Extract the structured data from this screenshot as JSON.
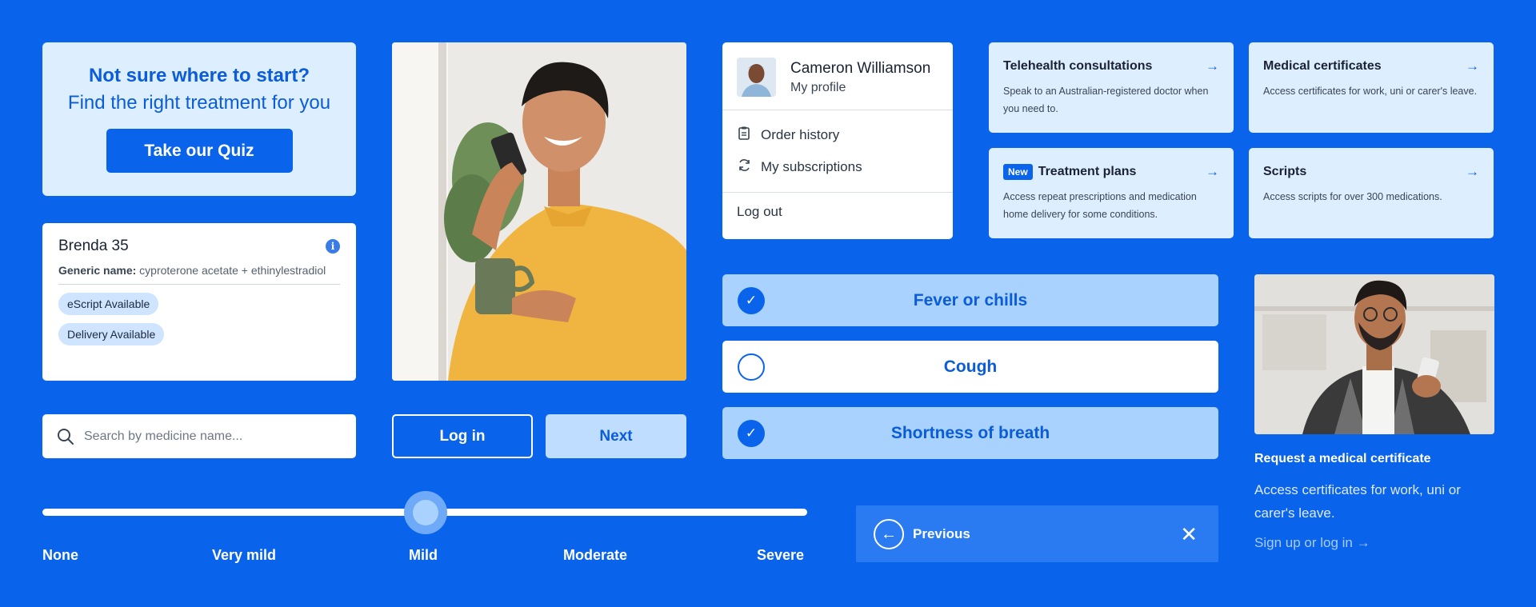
{
  "quiz": {
    "title": "Not sure where to start?",
    "subtitle": "Find the right treatment for you",
    "button_label": "Take our Quiz"
  },
  "medicine": {
    "name": "Brenda 35",
    "generic_label": "Generic name:",
    "generic_value": "cyproterone acetate + ethinylestradiol",
    "badges": [
      "eScript Available",
      "Delivery Available"
    ],
    "info_icon": "info-icon"
  },
  "search": {
    "placeholder": "Search by medicine name...",
    "icon": "search-icon"
  },
  "buttons": {
    "login_label": "Log in",
    "next_label": "Next"
  },
  "profile": {
    "name": "Cameron Williamson",
    "subtitle": "My profile",
    "menu": [
      {
        "label": "Order history",
        "icon": "clipboard-icon"
      },
      {
        "label": "My subscriptions",
        "icon": "refresh-icon"
      }
    ],
    "logout_label": "Log out"
  },
  "services": [
    {
      "title": "Telehealth consultations",
      "desc": "Speak to an Australian-registered doctor when you need to.",
      "badge": ""
    },
    {
      "title": "Medical certificates",
      "desc": "Access certificates for work, uni or carer's leave.",
      "badge": ""
    },
    {
      "title": "Treatment plans",
      "desc": "Access repeat prescriptions and medication home delivery for some conditions.",
      "badge": "New"
    },
    {
      "title": "Scripts",
      "desc": "Access scripts for over 300 medications.",
      "badge": ""
    }
  ],
  "symptoms": [
    {
      "label": "Fever or chills",
      "selected": true
    },
    {
      "label": "Cough",
      "selected": false
    },
    {
      "label": "Shortness of breath",
      "selected": true
    }
  ],
  "severity": {
    "labels": [
      "None",
      "Very mild",
      "Mild",
      "Moderate",
      "Severe"
    ],
    "selected_index": 2
  },
  "nav": {
    "previous_label": "Previous"
  },
  "certificate_card": {
    "title": "Request a medical certificate",
    "desc": "Access certificates for work, uni or carer's leave.",
    "link_label": "Sign up or log in"
  },
  "colors": {
    "background": "#0A63EB",
    "card_light": "#DDEEFF",
    "selected_option": "#A9D2FF",
    "accent_text": "#0A5CD8"
  }
}
